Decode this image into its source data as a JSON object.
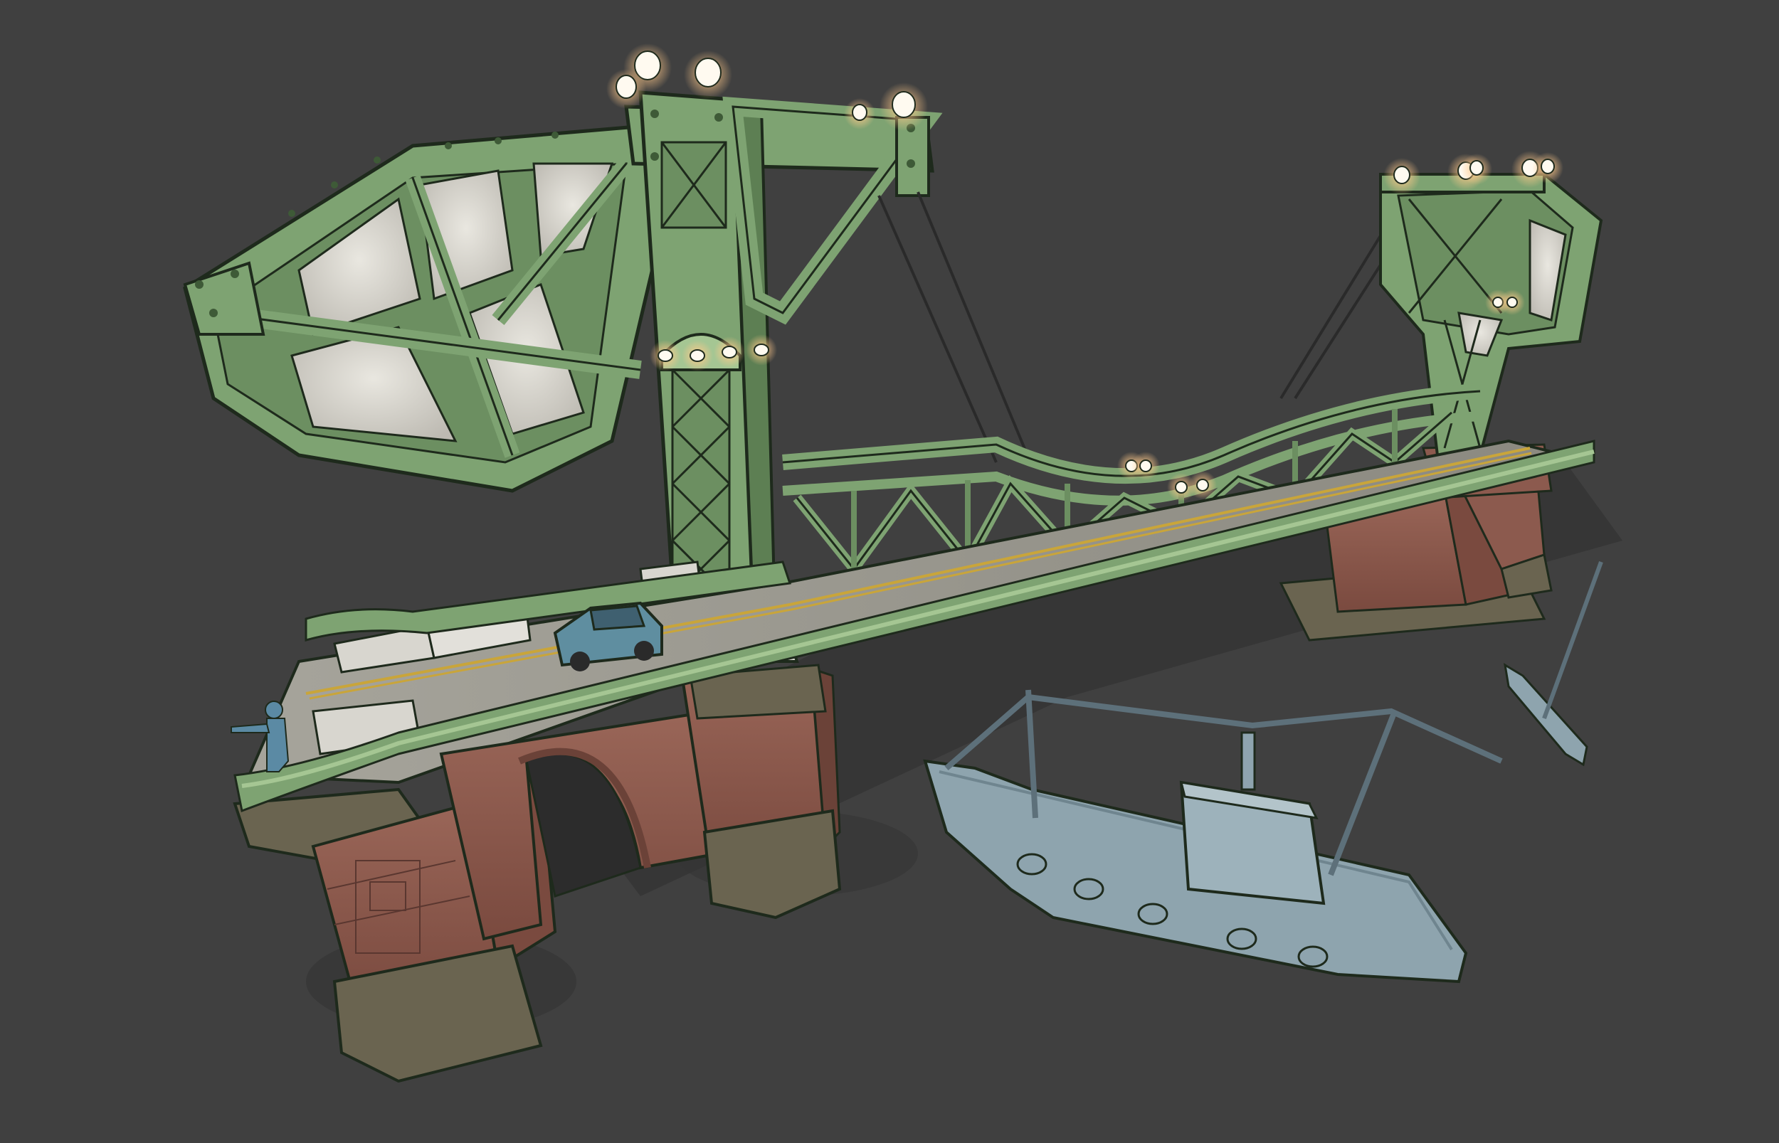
{
  "scene": {
    "subject": "bascule-bridge-render",
    "colors": {
      "background": "#404040",
      "steel": "#7ea372",
      "steel_dark": "#3e5a37",
      "steel_light": "#a5c693",
      "outline": "#1e2a1c",
      "brick": "#8c5a4e",
      "brick_dark": "#6b4238",
      "stone": "#6a6450",
      "road": "#8f8c82",
      "road_line": "#c9a53a",
      "panel": "#d8d6cf",
      "lamp": "#fffaf0",
      "lamp_glow": "#ffc98a",
      "placeholder_blue": "#8ea4ae",
      "car_blue": "#5f8ea0",
      "figure_blue": "#5b8aa4",
      "shadow": "#333333"
    },
    "icons": [
      "bridge-tower",
      "counterweight-frame",
      "street-lamp",
      "car",
      "fishing-boat",
      "sailboat",
      "person-figure"
    ]
  }
}
